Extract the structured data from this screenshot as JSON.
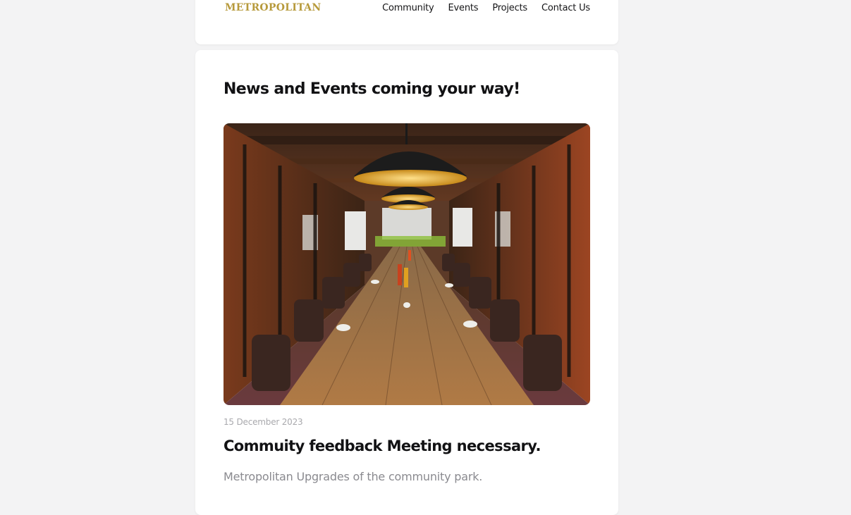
{
  "header": {
    "logo": "METROPOLITAN",
    "nav": [
      {
        "label": "Community"
      },
      {
        "label": "Events"
      },
      {
        "label": "Projects"
      },
      {
        "label": "Contact Us"
      }
    ]
  },
  "main": {
    "title": "News and Events coming your way!",
    "event": {
      "image_name": "meeting-room-photo",
      "date": "15 December 2023",
      "title": "Commuity feedback Meeting necessary.",
      "description": "Metropolitan Upgrades of the community park."
    }
  },
  "colors": {
    "page_bg": "#f3f3f4",
    "card_bg": "#ffffff",
    "logo_gold": "#b79a3c",
    "text_dark": "#121214",
    "text_muted": "#8a8a8f"
  }
}
